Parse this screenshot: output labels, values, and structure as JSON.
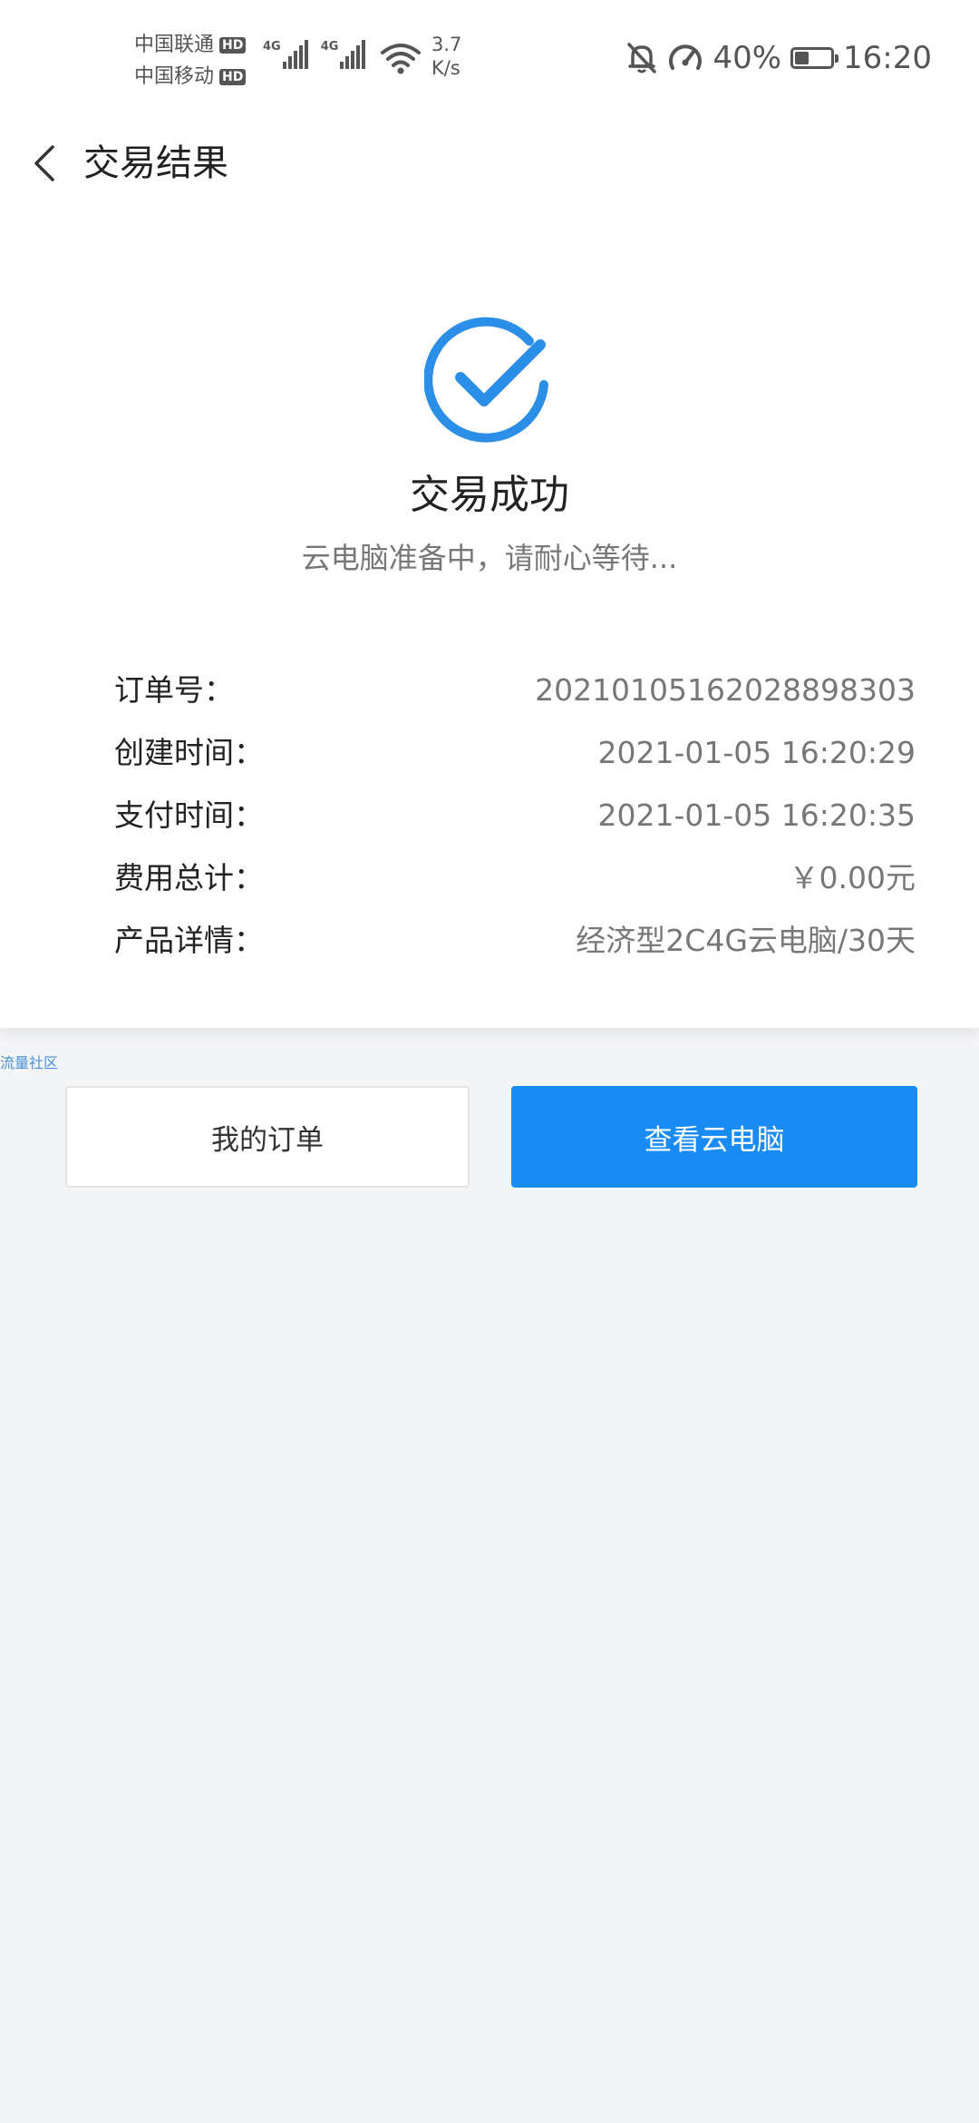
{
  "status_bar": {
    "carrier1": "中国联通",
    "carrier2": "中国移动",
    "hd_badge": "HD",
    "network_type1": "4G",
    "network_type2": "4G",
    "net_speed_value": "3.7",
    "net_speed_unit": "K/s",
    "battery_percent": "40%",
    "battery_level": 0.4,
    "time": "16:20"
  },
  "header": {
    "title": "交易结果"
  },
  "result": {
    "title": "交易成功",
    "subtitle": "云电脑准备中，请耐心等待...",
    "accent_color": "#2b8fe8"
  },
  "details": [
    {
      "label": "订单号：",
      "value": "20210105162028898303"
    },
    {
      "label": "创建时间：",
      "value": "2021-01-05 16:20:29"
    },
    {
      "label": "支付时间：",
      "value": "2021-01-05 16:20:35"
    },
    {
      "label": "费用总计：",
      "value": "￥0.00元"
    },
    {
      "label": "产品详情：",
      "value": "经济型2C4G云电脑/30天"
    }
  ],
  "watermark": "流量社区",
  "buttons": {
    "orders_label": "我的订单",
    "view_label": "查看云电脑",
    "primary_color": "#1a8bf3"
  }
}
